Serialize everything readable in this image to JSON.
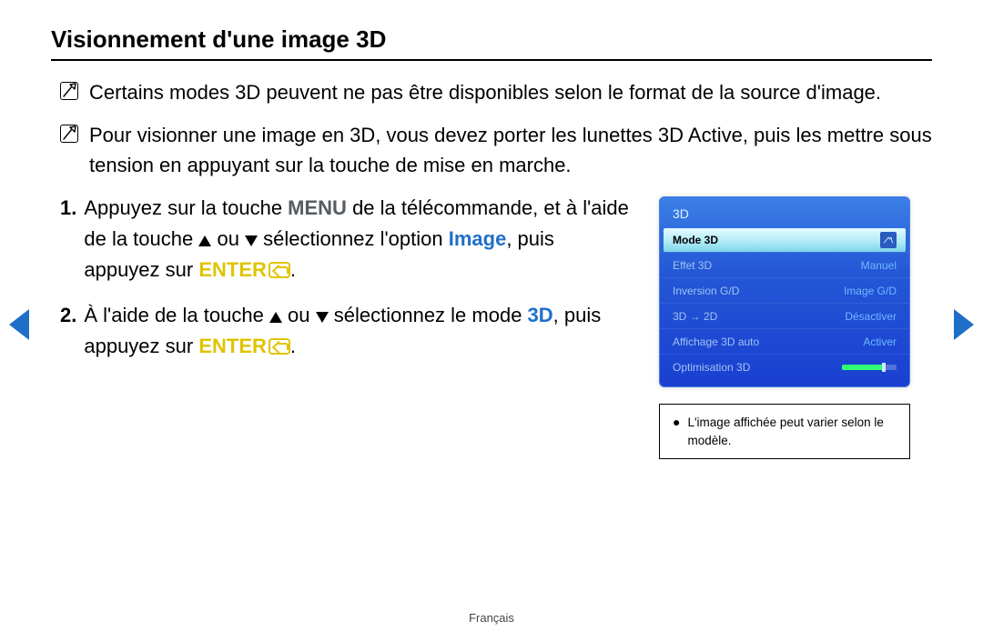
{
  "title": "Visionnement d'une image 3D",
  "notes": [
    "Certains modes 3D peuvent ne pas être disponibles selon le format de la source d'image.",
    "Pour visionner une image en 3D, vous devez porter les lunettes 3D Active, puis les mettre sous tension en appuyant sur la touche de mise en marche."
  ],
  "steps": {
    "s1": {
      "num": "1.",
      "t1a": "Appuyez sur la touche ",
      "menu": "MENU",
      "t1b": " de la télécommande, et à l'aide de la touche ",
      "t1c": " ou ",
      "t1d": " sélectionnez l'option ",
      "image": "Image",
      "t1e": ", puis appuyez sur ",
      "enter": "ENTER",
      "t1f": "."
    },
    "s2": {
      "num": "2.",
      "t2a": "À l'aide de la touche ",
      "t2b": " ou ",
      "t2c": " sélectionnez le mode ",
      "threeD": "3D",
      "t2d": ", puis appuyez sur ",
      "enter": "ENTER",
      "t2e": "."
    }
  },
  "menu": {
    "header": "3D",
    "rows": [
      {
        "label": "Mode 3D",
        "value": "",
        "selected": true
      },
      {
        "label": "Effet 3D",
        "value": "Manuel"
      },
      {
        "label": "Inversion G/D",
        "value": "Image G/D"
      },
      {
        "label": "3D → 2D",
        "value": "Désactiver"
      },
      {
        "label": "Affichage 3D auto",
        "value": "Activer"
      },
      {
        "label": "Optimisation 3D",
        "value": "",
        "slider": true
      }
    ]
  },
  "caption": "L'image affichée peut varier selon le modèle.",
  "footer": "Français"
}
